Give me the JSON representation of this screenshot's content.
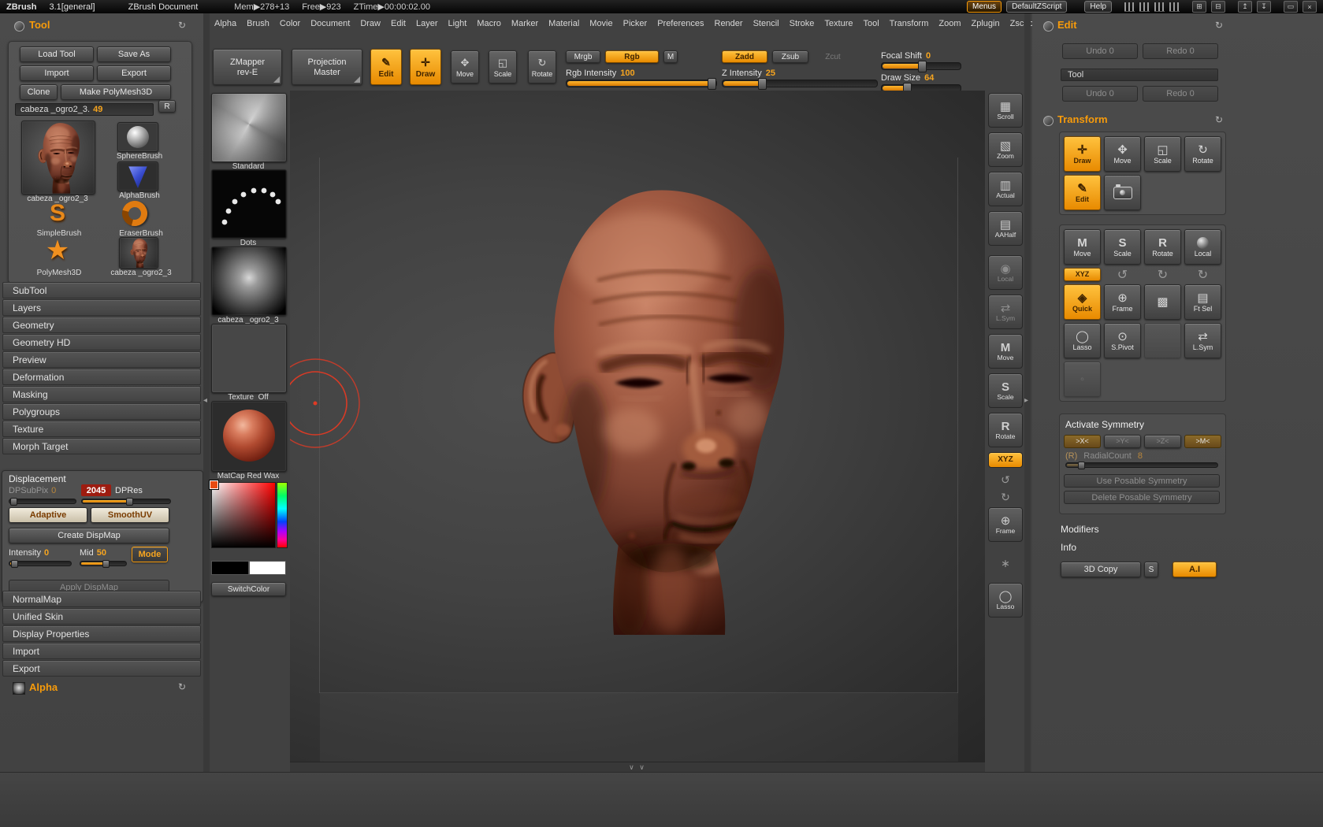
{
  "colors": {
    "accent": "#f79b0b",
    "editing_red": "#9e1c10",
    "cursor_red": "#e03a24",
    "matcap_red": "#b04a30"
  },
  "titlebar": {
    "app": "ZBrush",
    "version": "3.1[general]",
    "doc_title": "ZBrush Document",
    "mem": "Mem▶278+13",
    "free": "Free▶923",
    "ztime": "ZTime▶00:00:02.00",
    "menus": "Menus",
    "default_zscript": "DefaultZScript",
    "help": "Help",
    "icons": [
      "⊞",
      "⊟",
      "↥",
      "↧",
      "▭",
      "×"
    ]
  },
  "menubar": {
    "items": [
      "Alpha",
      "Brush",
      "Color",
      "Document",
      "Draw",
      "Edit",
      "Layer",
      "Light",
      "Macro",
      "Marker",
      "Material",
      "Movie",
      "Picker",
      "Preferences",
      "Render",
      "Stencil",
      "Stroke",
      "Texture",
      "Tool",
      "Transform",
      "Zoom",
      "Zplugin",
      "Zscript"
    ]
  },
  "top_toolbar": {
    "zmapper_1": "ZMapper",
    "zmapper_2": "rev-E",
    "projection_1": "Projection",
    "projection_2": "Master",
    "edit": "Edit",
    "draw": "Draw",
    "move": "Move",
    "scale": "Scale",
    "rotate": "Rotate",
    "mrgb": "Mrgb",
    "rgb": "Rgb",
    "m": "M",
    "rgb_intensity_label": "Rgb Intensity",
    "rgb_intensity_value": "100",
    "zadd": "Zadd",
    "zsub": "Zsub",
    "zcut": "Zcut",
    "z_intensity_label": "Z Intensity",
    "z_intensity_value": "25",
    "focal_shift_label": "Focal Shift",
    "focal_shift_value": "0",
    "draw_size_label": "Draw Size",
    "draw_size_value": "64"
  },
  "tool_panel": {
    "title": "Tool",
    "load_tool": "Load Tool",
    "save_as": "Save As",
    "import": "Import",
    "export": "Export",
    "clone": "Clone",
    "make_polymesh": "Make PolyMesh3D",
    "current_tool": "cabeza _ogro2_3.",
    "current_tool_value": "49",
    "r_button": "R",
    "thumbs": [
      "cabeza _ogro2_3",
      "SphereBrush",
      "AlphaBrush",
      "SimpleBrush",
      "EraserBrush",
      "PolyMesh3D",
      "cabeza _ogro2_3"
    ],
    "sections": [
      "SubTool",
      "Layers",
      "Geometry",
      "Geometry HD",
      "Preview",
      "Deformation",
      "Masking",
      "Polygroups",
      "Texture",
      "Morph Target"
    ],
    "displacement": {
      "title": "Displacement",
      "dpsubpix_label": "DPSubPix",
      "dpsubpix_value": "0",
      "dpres_value": "2045",
      "dpres_label": "DPRes",
      "adaptive": "Adaptive",
      "smooth_uv": "SmoothUV",
      "create_dispmap": "Create DispMap",
      "intensity_label": "Intensity",
      "intensity_value": "0",
      "mid_label": "Mid",
      "mid_value": "50",
      "mode": "Mode",
      "apply_dispmap": "Apply DispMap"
    },
    "sections_bottom": [
      "NormalMap",
      "Unified Skin",
      "Display Properties",
      "Import",
      "Export"
    ],
    "alpha_title": "Alpha"
  },
  "shelf": {
    "brush": "Standard",
    "stroke": "Dots",
    "alpha": "cabeza _ogro2_3",
    "texture": "Texture  Off",
    "material": "MatCap Red Wax",
    "switch_color": "SwitchColor"
  },
  "right_strip": {
    "items": [
      {
        "icon": "▦",
        "label": "Scroll"
      },
      {
        "icon": "▧",
        "label": "Zoom"
      },
      {
        "icon": "▥",
        "label": "Actual"
      },
      {
        "icon": "▤",
        "label": "AAHalf"
      },
      {
        "icon": "◉",
        "label": "Local"
      },
      {
        "icon": "⇄",
        "label": "L.Sym"
      },
      {
        "icon": "M",
        "label": "Move"
      },
      {
        "icon": "S",
        "label": "Scale"
      },
      {
        "icon": "R",
        "label": "Rotate"
      },
      {
        "icon": "",
        "label": "XYZ"
      },
      {
        "icon": "↺",
        "label": ""
      },
      {
        "icon": "↻",
        "label": ""
      },
      {
        "icon": "⊕",
        "label": "Frame"
      },
      {
        "icon": "∗",
        "label": ""
      },
      {
        "icon": "◯",
        "label": "Lasso"
      }
    ]
  },
  "edit_panel": {
    "title": "Edit",
    "undo": "Undo 0",
    "redo": "Redo 0",
    "tool_bar": "Tool",
    "tool_undo": "Undo 0",
    "tool_redo": "Redo 0",
    "transform_title": "Transform",
    "modes": [
      {
        "icon": "✛",
        "label": "Draw"
      },
      {
        "icon": "✥",
        "label": "Move"
      },
      {
        "icon": "◱",
        "label": "Scale"
      },
      {
        "icon": "↻",
        "label": "Rotate"
      }
    ],
    "edit_icon": "✎",
    "edit_label": "Edit",
    "nav": [
      {
        "icon": "M",
        "label": "Move"
      },
      {
        "icon": "S",
        "label": "Scale"
      },
      {
        "icon": "R",
        "label": "Rotate"
      },
      {
        "icon": "",
        "label": "Local"
      }
    ],
    "xyz": "XYZ",
    "axis_icons": [
      "↺",
      "↻",
      "↻"
    ],
    "row3": [
      {
        "icon": "◈",
        "label": "Quick"
      },
      {
        "icon": "⊕",
        "label": "Frame"
      },
      {
        "icon": "▩",
        "label": ""
      },
      {
        "icon": "▤",
        "label": "Ft Sel"
      }
    ],
    "row4": [
      {
        "icon": "◯",
        "label": "Lasso"
      },
      {
        "icon": "⊙",
        "label": "S.Pivot"
      },
      {
        "icon": "",
        "label": ""
      },
      {
        "icon": "⇄",
        "label": "L.Sym"
      }
    ],
    "row5_icon": "◦",
    "symmetry": {
      "title": "Activate Symmetry",
      "buttons": [
        ">X<",
        ">Y<",
        ">Z<",
        ">M<"
      ],
      "r_label": "(R)",
      "radial_label": "RadialCount",
      "radial_value": "8",
      "use_posable": "Use Posable Symmetry",
      "delete_posable": "Delete Posable Symmetry"
    },
    "modifiers": "Modifiers",
    "info": "Info",
    "copy3d": "3D Copy",
    "s_label": "S",
    "ai": "A.I"
  },
  "icons": {
    "refresh": "↻",
    "divider_left": "◂",
    "divider_right": "▸",
    "scroll_chevrons": "∨ ∨"
  }
}
